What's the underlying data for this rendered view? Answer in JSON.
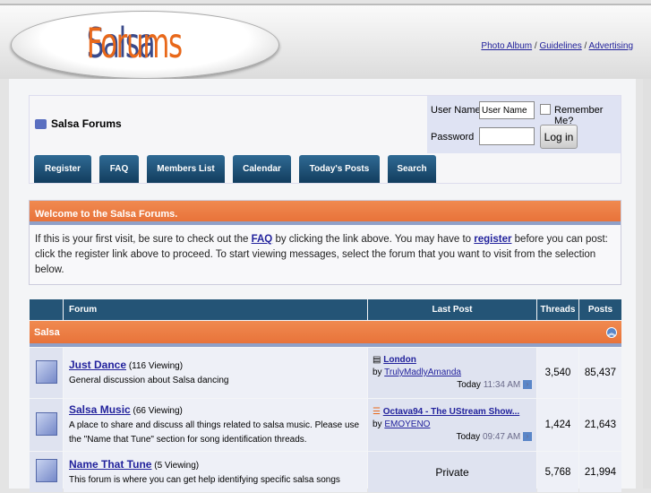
{
  "logo": {
    "part1": "Salsa",
    "part2": "Forums"
  },
  "toplinks": [
    "Photo Album",
    "Guidelines",
    "Advertising"
  ],
  "breadcrumb": "Salsa Forums",
  "login": {
    "username_label": "User Name",
    "username_value": "User Name",
    "remember": "Remember Me?",
    "password_label": "Password",
    "button": "Log in"
  },
  "nav": [
    "Register",
    "FAQ",
    "Members List",
    "Calendar",
    "Today's Posts",
    "Search"
  ],
  "welcome": {
    "title": "Welcome to the Salsa Forums.",
    "t1": "If this is your first visit, be sure to check out the ",
    "faq": "FAQ",
    "t2": " by clicking the link above. You may have to ",
    "register": "register",
    "t3": " before you can post: click the register link above to proceed. To start viewing messages, select the forum that you want to visit from the selection below."
  },
  "table": {
    "headers": [
      "Forum",
      "Last Post",
      "Threads",
      "Posts"
    ],
    "category": "Salsa",
    "forums": [
      {
        "name": "Just Dance",
        "viewing": "(116 Viewing)",
        "desc": "General discussion about Salsa dancing",
        "last_title": "London",
        "by": "by",
        "last_user": "TrulyMadlyAmanda",
        "day": "Today",
        "time": "11:34 AM",
        "threads": "3,540",
        "posts": "85,437"
      },
      {
        "name": "Salsa Music",
        "viewing": "(66 Viewing)",
        "desc": "A place to share and discuss all things related to salsa music. Please use the \"Name that Tune\" section for song identification threads.",
        "last_title": "Octava94 - The UStream Show...",
        "by": "by",
        "last_user": "EMOYENO",
        "day": "Today",
        "time": "09:47 AM",
        "threads": "1,424",
        "posts": "21,643"
      },
      {
        "name": "Name That Tune",
        "viewing": "(5 Viewing)",
        "desc": "This forum is where you can get help identifying specific salsa songs",
        "private": "Private",
        "threads": "5,768",
        "posts": "21,994"
      }
    ]
  }
}
